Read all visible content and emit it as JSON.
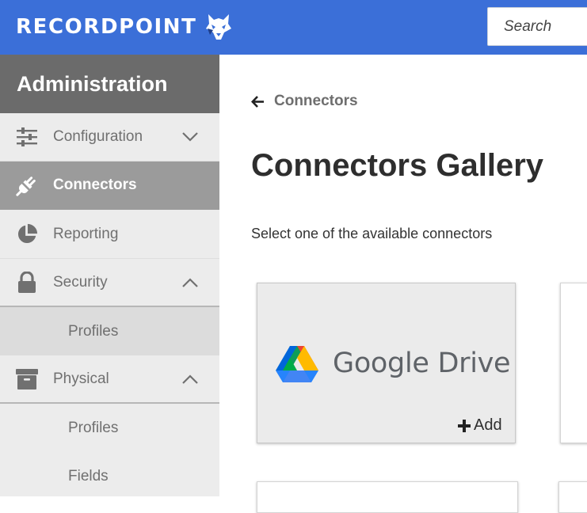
{
  "header": {
    "brand": "RECORDPOINT",
    "search_placeholder": "Search",
    "brand_color": "#3b6fd8"
  },
  "sidebar": {
    "title": "Administration",
    "items": [
      {
        "label": "Configuration",
        "icon": "sliders-icon",
        "chevron": "down"
      },
      {
        "label": "Connectors",
        "icon": "plug-icon",
        "active": true
      },
      {
        "label": "Reporting",
        "icon": "pie-chart-icon"
      },
      {
        "label": "Security",
        "icon": "lock-icon",
        "chevron": "up",
        "children": [
          {
            "label": "Profiles"
          }
        ]
      },
      {
        "label": "Physical",
        "icon": "archive-box-icon",
        "chevron": "up",
        "children": [
          {
            "label": "Profiles"
          },
          {
            "label": "Fields"
          }
        ]
      }
    ]
  },
  "main": {
    "back_label": "Connectors",
    "title": "Connectors Gallery",
    "subtitle": "Select one of the available connectors",
    "cards": [
      {
        "name": "Google Drive",
        "icon": "google-drive-icon",
        "action": "Add"
      }
    ]
  }
}
